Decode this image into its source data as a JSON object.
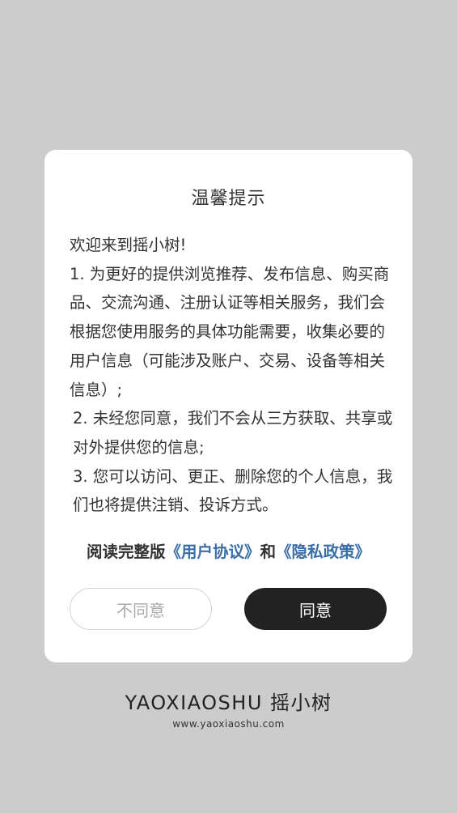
{
  "dialog": {
    "title": "温馨提示",
    "paragraphs": [
      "欢迎来到摇小树!",
      "1. 为更好的提供浏览推荐、发布信息、购买商品、交流沟通、注册认证等相关服务，我们会根据您使用服务的具体功能需要，收集必要的用户信息（可能涉及账户、交易、设备等相关信息）;",
      "2. 未经您同意，我们不会从三方获取、共享或对外提供您的信息;",
      "3. 您可以访问、更正、删除您的个人信息，我们也将提供注销、投诉方式。"
    ],
    "read_prefix": "阅读完整版",
    "user_agreement": "《用户协议》",
    "and": "和",
    "privacy_policy": "《隐私政策》",
    "disagree_label": "不同意",
    "agree_label": "同意"
  },
  "brand": {
    "name": "YAOXIAOSHU 摇小树",
    "url": "www.yaoxiaoshu.com"
  }
}
